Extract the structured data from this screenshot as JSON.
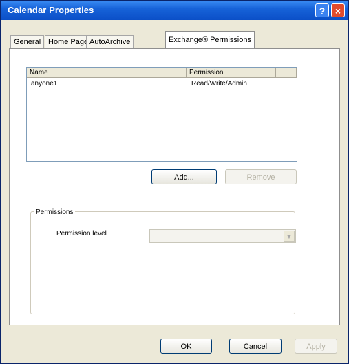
{
  "window": {
    "title": "Calendar Properties",
    "help_glyph": "?",
    "close_glyph": "×"
  },
  "tabs": [
    {
      "label": "General"
    },
    {
      "label": "Home Page"
    },
    {
      "label": "AutoArchive"
    },
    {
      "label": "Exchange® Permissions"
    }
  ],
  "permissions_list": {
    "columns": [
      "Name",
      "Permission"
    ],
    "rows": [
      {
        "name": "anyone1",
        "permission": "Read/Write/Admin"
      }
    ]
  },
  "buttons": {
    "add": "Add...",
    "remove": "Remove"
  },
  "permissions_group": {
    "legend": "Permissions",
    "level_label": "Permission level",
    "level_value": ""
  },
  "footer": {
    "ok": "OK",
    "cancel": "Cancel",
    "apply": "Apply"
  }
}
